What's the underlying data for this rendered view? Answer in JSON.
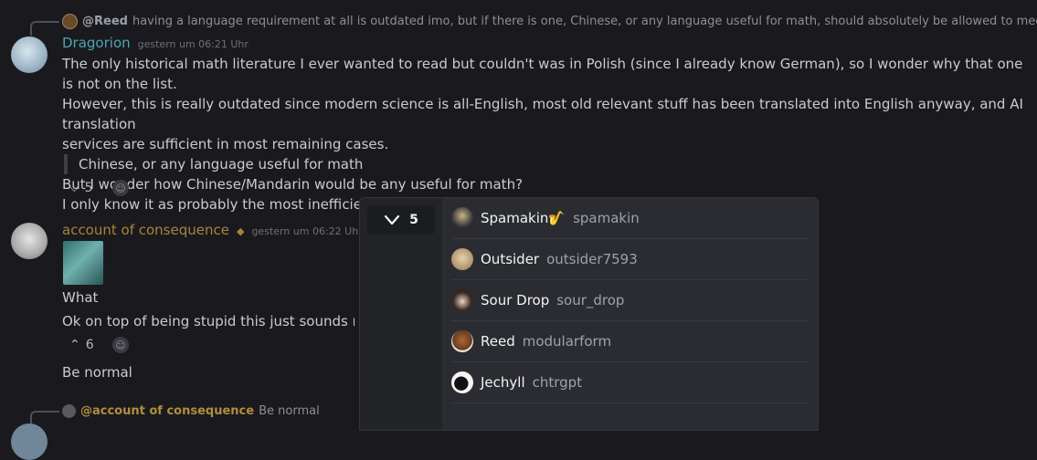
{
  "messages": {
    "m1": {
      "reply_prefix": "@Reed",
      "reply_text": "having a language requirement at all is outdated imo, but if there is one, Chinese, or any language useful for math, should absolutely be allowed to meet it",
      "author": "Dragorion",
      "timestamp": "gestern um 06:21 Uhr",
      "lines": [
        "The only historical math literature I ever wanted to read but couldn't was in Polish (since I already know German), so I wonder why that one is not on the list.",
        "However, this is really outdated since modern science is all-English, most old relevant stuff has been translated into English anyway, and AI translation",
        "services are sufficient in most remaining cases."
      ],
      "quote": "Chinese, or any language useful for math",
      "lines_after": [
        "But I wonder how Chinese/Mandarin would be any useful for math?",
        "I only know it as probably the most inefficient garbage language on Earth."
      ],
      "reaction_count": "5"
    },
    "m2": {
      "author": "account of consequence",
      "timestamp": "gestern um 06:22 Uhr",
      "line1": "What",
      "line2": "Ok on top of being stupid this just sounds really",
      "reaction_count": "6",
      "line3": "Be normal"
    },
    "m3": {
      "reply_prefix": "@account of consequence",
      "reply_text": "Be normal"
    }
  },
  "popup": {
    "tab_count": "5",
    "users": [
      {
        "display": "Spamakin",
        "handle": "spamakin",
        "suffix": "🎷"
      },
      {
        "display": "Outsider",
        "handle": "outsider7593"
      },
      {
        "display": "Sour Drop",
        "handle": "sour_drop"
      },
      {
        "display": "Reed",
        "handle": "modularform"
      },
      {
        "display": "Jechyll",
        "handle": "chtrgpt"
      }
    ]
  },
  "colors": {
    "accent_cyan": "#4ea3b8",
    "accent_gold": "#a8843a",
    "background": "#1a1a1e"
  }
}
